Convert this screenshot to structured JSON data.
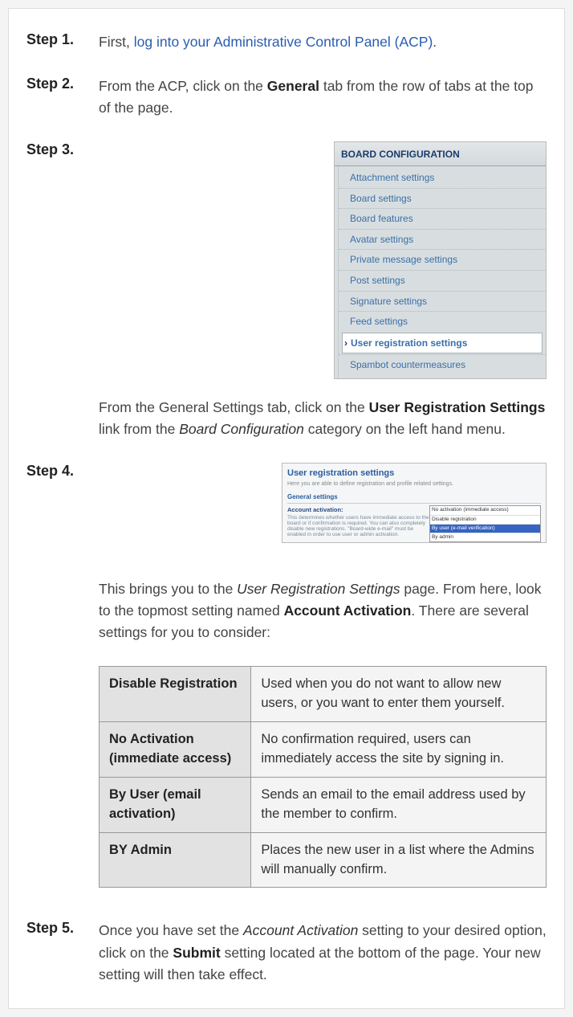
{
  "steps": {
    "s1": {
      "label": "Step 1.",
      "pre": "First, ",
      "link": "log into your Administrative Control Panel (ACP)",
      "post": "."
    },
    "s2": {
      "label": "Step 2.",
      "t1": "From the ACP, click on the ",
      "bold": "General",
      "t2": " tab from the row of tabs at the top of the page."
    },
    "s3": {
      "label": "Step 3.",
      "board_header": "BOARD CONFIGURATION",
      "menu": [
        "Attachment settings",
        "Board settings",
        "Board features",
        "Avatar settings",
        "Private message settings",
        "Post settings",
        "Signature settings",
        "Feed settings"
      ],
      "menu_highlight": "User registration settings",
      "menu_after": "Spambot countermeasures",
      "para_a": "From the General Settings tab, click on the ",
      "para_bold": "User Registration Settings",
      "para_b": " link from the ",
      "para_italic": "Board Configuration",
      "para_c": " category on the left hand menu."
    },
    "s4": {
      "label": "Step 4.",
      "ss_title": "User registration settings",
      "ss_sub": "Here you are able to define registration and profile related settings.",
      "ss_gs": "General settings",
      "ss_acc_label": "Account activation:",
      "ss_acc_sub": "This determines whether users have immediate access to the board or if confirmation is required. You can also completely disable new registrations. \"Board-wide e-mail\" must be enabled in order to use user or admin activation.",
      "ss_opts": [
        "No activation (immediate access)",
        "Disable registration",
        "By user (e-mail verification)",
        "By admin"
      ],
      "p1a": "This brings you to the ",
      "p1i": "User Registration Settings",
      "p1b": " page. From here, look to the topmost setting named ",
      "p1bold": "Account Activation",
      "p1c": ". There are several settings for you to consider:",
      "table": [
        {
          "k": "Disable Registration",
          "v": "Used when you do not want to allow new users, or you want to enter them yourself."
        },
        {
          "k": "No Activation (immediate access)",
          "v": "No confirmation required, users can immediately access the site by signing in."
        },
        {
          "k": "By User (email activation)",
          "v": "Sends an email to the email address used by the member to confirm."
        },
        {
          "k": "BY Admin",
          "v": "Places the new user in a list where the Admins will manually confirm."
        }
      ]
    },
    "s5": {
      "label": "Step 5.",
      "a": "Once you have set the ",
      "i": "Account Activation",
      "b": " setting to your desired option, click on the ",
      "bold": "Submit",
      "c": " setting located at the bottom of the page. Your new setting will then take effect."
    }
  }
}
